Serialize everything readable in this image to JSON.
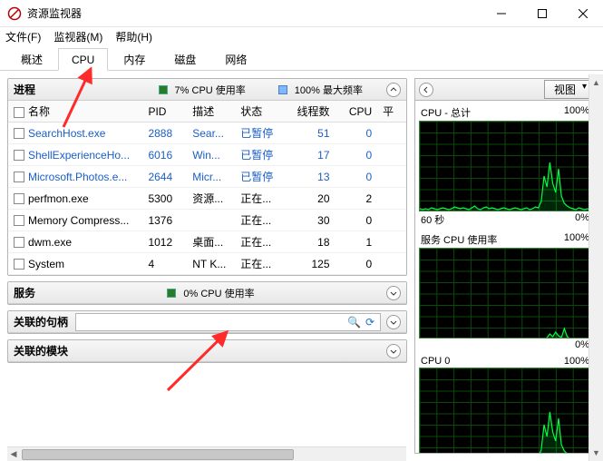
{
  "window": {
    "title": "资源监视器"
  },
  "menu": {
    "file": "文件(F)",
    "monitor": "监视器(M)",
    "help": "帮助(H)"
  },
  "tabs": {
    "overview": "概述",
    "cpu": "CPU",
    "memory": "内存",
    "disk": "磁盘",
    "network": "网络"
  },
  "processes": {
    "title": "进程",
    "usage1": "7% CPU 使用率",
    "usage2": "100% 最大频率",
    "columns": {
      "name": "名称",
      "pid": "PID",
      "desc": "描述",
      "state": "状态",
      "threads": "线程数",
      "cpu": "CPU",
      "avg": "平"
    },
    "rows": [
      {
        "name": "SearchHost.exe",
        "pid": "2888",
        "desc": "Sear...",
        "state": "已暂停",
        "threads": "51",
        "cpu": "0",
        "linked": true
      },
      {
        "name": "ShellExperienceHo...",
        "pid": "6016",
        "desc": "Win...",
        "state": "已暂停",
        "threads": "17",
        "cpu": "0",
        "linked": true
      },
      {
        "name": "Microsoft.Photos.e...",
        "pid": "2644",
        "desc": "Micr...",
        "state": "已暂停",
        "threads": "13",
        "cpu": "0",
        "linked": true
      },
      {
        "name": "perfmon.exe",
        "pid": "5300",
        "desc": "资源...",
        "state": "正在...",
        "threads": "20",
        "cpu": "2",
        "linked": false
      },
      {
        "name": "Memory Compress...",
        "pid": "1376",
        "desc": "",
        "state": "正在...",
        "threads": "30",
        "cpu": "0",
        "linked": false
      },
      {
        "name": "dwm.exe",
        "pid": "1012",
        "desc": "桌面...",
        "state": "正在...",
        "threads": "18",
        "cpu": "1",
        "linked": false
      },
      {
        "name": "System",
        "pid": "4",
        "desc": "NT K...",
        "state": "正在...",
        "threads": "125",
        "cpu": "0",
        "linked": false
      }
    ]
  },
  "services": {
    "title": "服务",
    "usage": "0% CPU 使用率"
  },
  "handles": {
    "title": "关联的句柄"
  },
  "modules": {
    "title": "关联的模块"
  },
  "right": {
    "view": "视图",
    "graphs": [
      {
        "title": "CPU - 总计",
        "right": "100%",
        "foot_left": "60 秒",
        "foot_right": "0%"
      },
      {
        "title": "服务 CPU 使用率",
        "right": "100%",
        "foot_left": "",
        "foot_right": "0%"
      },
      {
        "title": "CPU 0",
        "right": "100%",
        "foot_left": "",
        "foot_right": ""
      }
    ]
  },
  "chart_data": [
    {
      "type": "line",
      "title": "CPU - 总计",
      "xlabel": "60 秒",
      "ylabel": "",
      "ylim": [
        0,
        100
      ],
      "values": [
        4,
        3,
        4,
        3,
        5,
        4,
        3,
        4,
        5,
        4,
        3,
        4,
        6,
        5,
        4,
        5,
        4,
        3,
        5,
        7,
        4,
        3,
        5,
        6,
        4,
        5,
        4,
        3,
        4,
        5,
        4,
        3,
        4,
        5,
        4,
        3,
        4,
        5,
        3,
        4,
        6,
        5,
        12,
        40,
        28,
        55,
        32,
        22,
        48,
        18,
        10,
        7,
        5,
        4,
        3,
        5,
        4,
        3,
        4,
        3
      ]
    },
    {
      "type": "line",
      "title": "服务 CPU 使用率",
      "ylim": [
        0,
        100
      ],
      "values": [
        0,
        0,
        0,
        0,
        0,
        0,
        0,
        0,
        0,
        0,
        0,
        0,
        0,
        0,
        0,
        0,
        0,
        0,
        0,
        0,
        0,
        0,
        0,
        0,
        0,
        0,
        0,
        0,
        0,
        0,
        0,
        0,
        0,
        0,
        0,
        0,
        0,
        0,
        0,
        0,
        0,
        0,
        0,
        0,
        2,
        6,
        3,
        8,
        4,
        2,
        12,
        3,
        1,
        0,
        0,
        0,
        0,
        0,
        0,
        0
      ]
    },
    {
      "type": "line",
      "title": "CPU 0",
      "ylim": [
        0,
        100
      ],
      "values": [
        2,
        3,
        2,
        4,
        3,
        2,
        3,
        4,
        2,
        3,
        5,
        3,
        2,
        3,
        4,
        2,
        3,
        4,
        3,
        2,
        3,
        4,
        2,
        3,
        5,
        3,
        2,
        4,
        3,
        2,
        3,
        5,
        4,
        2,
        3,
        4,
        3,
        2,
        3,
        4,
        5,
        3,
        10,
        38,
        25,
        52,
        30,
        20,
        45,
        16,
        9,
        6,
        4,
        3,
        2,
        4,
        3,
        2,
        3,
        2
      ]
    }
  ]
}
